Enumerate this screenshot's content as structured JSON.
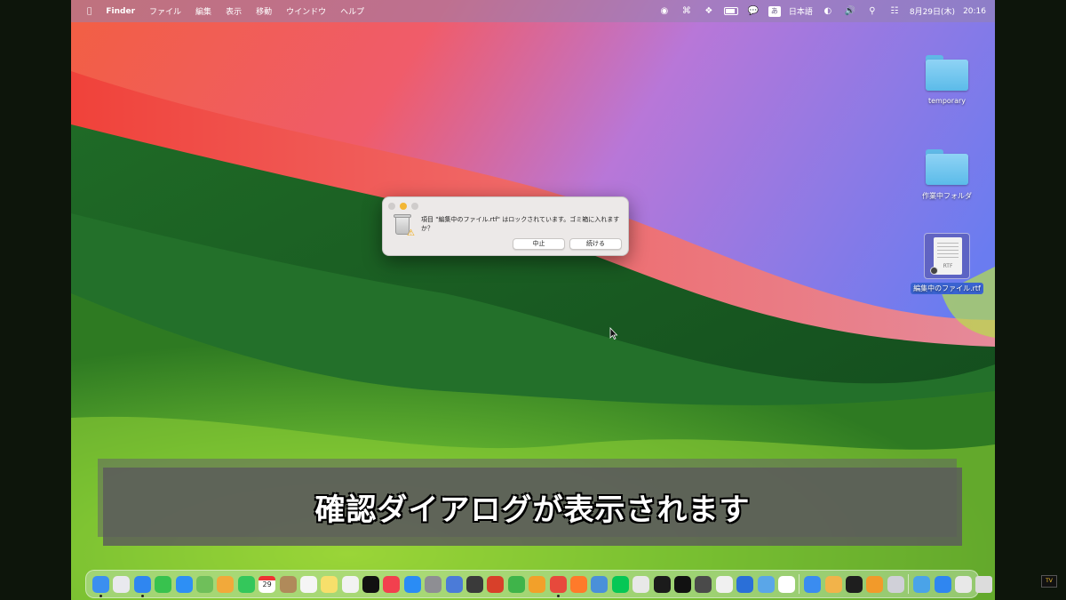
{
  "menubar": {
    "app_name": "Finder",
    "items": [
      "ファイル",
      "編集",
      "表示",
      "移動",
      "ウインドウ",
      "ヘルプ"
    ],
    "input_method": "あ",
    "input_method_label": "日本語",
    "battery_level": 0.7,
    "date": "8月29日(木)",
    "time": "20:16"
  },
  "desktop": {
    "icons": [
      {
        "label": "temporary",
        "kind": "folder"
      },
      {
        "label": "作業中フォルダ",
        "kind": "folder"
      },
      {
        "label": "編集中のファイル.rtf",
        "kind": "rtf-document",
        "selected": true,
        "file_ext": "RTF"
      }
    ]
  },
  "dialog": {
    "message": "項目 \"編集中のファイル.rtf\" はロックされています。ゴミ箱に入れますか？",
    "cancel_label": "中止",
    "continue_label": "続ける"
  },
  "caption": {
    "text": "確認ダイアログが表示されます"
  },
  "dock": {
    "calendar_day": "29",
    "apps": [
      {
        "name": "finder",
        "color": "#3b8ff0",
        "running": true
      },
      {
        "name": "launchpad",
        "color": "#e9e9ee"
      },
      {
        "name": "safari",
        "color": "#2f86f0",
        "running": true
      },
      {
        "name": "messages",
        "color": "#38c24e"
      },
      {
        "name": "mail",
        "color": "#2d8ff5"
      },
      {
        "name": "maps",
        "color": "#6fbf5a"
      },
      {
        "name": "photos",
        "color": "#f2a93a"
      },
      {
        "name": "facetime",
        "color": "#34c75b"
      },
      {
        "name": "calendar",
        "color": "#ffffff"
      },
      {
        "name": "contacts",
        "color": "#b08a5a"
      },
      {
        "name": "reminders",
        "color": "#f5f5f5"
      },
      {
        "name": "notes",
        "color": "#f7df6b"
      },
      {
        "name": "freeform",
        "color": "#f2f2f2"
      },
      {
        "name": "tv",
        "color": "#111111"
      },
      {
        "name": "music",
        "color": "#f2404e"
      },
      {
        "name": "app-store",
        "color": "#2a8cf5"
      },
      {
        "name": "system-settings",
        "color": "#8e8e93"
      },
      {
        "name": "preview",
        "color": "#4b7bd8"
      },
      {
        "name": "photo-booth",
        "color": "#3a3a3a"
      },
      {
        "name": "migration",
        "color": "#d8402a"
      },
      {
        "name": "numbers",
        "color": "#3fb44a"
      },
      {
        "name": "keynote",
        "color": "#f2a02a"
      },
      {
        "name": "chrome",
        "color": "#e7493c",
        "running": true
      },
      {
        "name": "firefox",
        "color": "#ff7a2a"
      },
      {
        "name": "diagram-app",
        "color": "#4a90d9"
      },
      {
        "name": "line",
        "color": "#06c755"
      },
      {
        "name": "pen-app",
        "color": "#e8e8e8"
      },
      {
        "name": "cursor-app",
        "color": "#1b1b1b"
      },
      {
        "name": "xcode-like",
        "color": "#111111"
      },
      {
        "name": "calculator",
        "color": "#4a4a4a"
      },
      {
        "name": "textedit",
        "color": "#f0f0f0"
      },
      {
        "name": "hand-app",
        "color": "#2a6fd8"
      },
      {
        "name": "finder-folder",
        "color": "#5aa6e8"
      },
      {
        "name": "chatgpt",
        "color": "#ffffff"
      },
      {
        "name": "testflight",
        "color": "#3a8cf0"
      },
      {
        "name": "office-app",
        "color": "#f2b34a"
      },
      {
        "name": "quicktime",
        "color": "#1e1e1e"
      },
      {
        "name": "pencil-app",
        "color": "#f29a2a"
      },
      {
        "name": "floppy-app",
        "color": "#d0d0d8"
      },
      {
        "name": "downloads",
        "color": "#4aa3e8"
      },
      {
        "name": "globe",
        "color": "#2f86f0"
      },
      {
        "name": "blank-window",
        "color": "#e8e8e8"
      },
      {
        "name": "trash",
        "color": "#dcdcdc"
      }
    ]
  },
  "colors": {
    "menubar": "#9682af",
    "dialog": "#ece9e8",
    "folder": "#5bbbe9",
    "selection": "#3a63d1"
  }
}
